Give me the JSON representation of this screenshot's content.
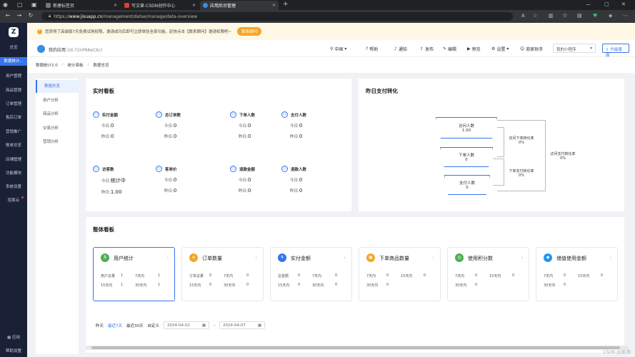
{
  "browser": {
    "tabs": [
      {
        "title": "新建标签页"
      },
      {
        "title": "写文章-CSDN创作中心"
      },
      {
        "title": "应用后台管理"
      }
    ],
    "url_prefix": "https://",
    "url_host": "www.jisuapp.cn",
    "url_path": "/management/datax/manage/data-overview"
  },
  "sidebar": {
    "logo": "Z",
    "top_label": "总览",
    "items": [
      {
        "label": "数据统计..."
      },
      {
        "label": "用户管理"
      },
      {
        "label": "商品管理"
      },
      {
        "label": "订单管理"
      },
      {
        "label": "售后订单"
      },
      {
        "label": "营销推广"
      },
      {
        "label": "账单总览"
      },
      {
        "label": "店铺管理"
      },
      {
        "label": "功能模块"
      },
      {
        "label": "系统设置"
      },
      {
        "label": "招客云"
      }
    ],
    "bottom_items": [
      {
        "label": "应用"
      },
      {
        "label": "帮助设置"
      }
    ]
  },
  "notice": {
    "text": "您获得了高级版7天免费试用权限，邀请成功后即可立即体验全部功能，赶快点击【联系顾问】邀请权限吧~",
    "button": "联系顾问"
  },
  "header": {
    "app_name": "我的应用",
    "app_id": "(id:72nP6KeC6c)",
    "region": "中国",
    "items": [
      "帮助",
      "通知",
      "发布",
      "编辑",
      "预览",
      "设置",
      "商家助手"
    ],
    "select": "我的小程序",
    "upgrade": "升级版面"
  },
  "breadcrumb": [
    "数据统计2.0",
    "统计面板",
    "数据总览"
  ],
  "subnav": [
    "数据总览",
    "用户分析",
    "商品分析",
    "交易分析",
    "营销分析"
  ],
  "realtime": {
    "title": "实时看板",
    "today_prefix": "今日:",
    "yesterday_prefix": "昨日:",
    "metrics": [
      {
        "name": "实付金额",
        "today": "0",
        "yesterday": "0"
      },
      {
        "name": "总订单数",
        "today": "0",
        "yesterday": "0"
      },
      {
        "name": "下单人数",
        "today": "0",
        "yesterday": "0"
      },
      {
        "name": "支付人数",
        "today": "0",
        "yesterday": "0"
      },
      {
        "name": "访客数",
        "today": "统计中",
        "yesterday": "1.00"
      },
      {
        "name": "客单价",
        "today": "0",
        "yesterday": "0"
      },
      {
        "name": "退款金额",
        "today": "0",
        "yesterday": "0"
      },
      {
        "name": "退款人数",
        "today": "0",
        "yesterday": "0"
      }
    ]
  },
  "funnel": {
    "title": "昨日支付转化",
    "stages": [
      {
        "name": "访问人数",
        "value": "1.00"
      },
      {
        "name": "下单人数",
        "value": "0"
      },
      {
        "name": "支付人数",
        "value": "0"
      }
    ],
    "rates": [
      {
        "name": "访问下单转化率",
        "value": "0%"
      },
      {
        "name": "下单支付转化率",
        "value": "0%"
      },
      {
        "name": "访问支付转化率",
        "value": "0%"
      }
    ]
  },
  "overall": {
    "title": "整体看板",
    "cards": [
      {
        "title": "用户统计",
        "color": "#4caf50",
        "glyph": "8",
        "rows": [
          [
            "用户总量",
            "1",
            "7天内",
            "1"
          ],
          [
            "15天内",
            "1",
            "30天内",
            "1"
          ]
        ]
      },
      {
        "title": "订单数量",
        "color": "#f5a623",
        "glyph": "≡",
        "rows": [
          [
            "订单总量",
            "0",
            "7天内",
            "0"
          ],
          [
            "15天内",
            "0",
            "30天内",
            "0"
          ]
        ]
      },
      {
        "title": "实付金额",
        "color": "#3574ee",
        "glyph": "¥",
        "rows": [
          [
            "总金额",
            "0",
            "7天内",
            "0"
          ],
          [
            "15天内",
            "0",
            "30天内",
            "0"
          ]
        ]
      },
      {
        "title": "下单商品数量",
        "color": "#f5a623",
        "glyph": "▣",
        "rows": [
          [
            "7天内",
            "0",
            "15天内",
            "0"
          ],
          [
            "30天内",
            "0",
            "",
            ""
          ]
        ]
      },
      {
        "title": "使用积分数",
        "color": "#4caf50",
        "glyph": "◎",
        "rows": [
          [
            "7天内",
            "0",
            "15天内",
            "0"
          ],
          [
            "30天内",
            "0",
            "",
            ""
          ]
        ]
      },
      {
        "title": "储值使用金额",
        "color": "#2196f3",
        "glyph": "◆",
        "rows": [
          [
            "7天内",
            "0",
            "15天内",
            "0"
          ],
          [
            "30天内",
            "0",
            "",
            ""
          ]
        ]
      }
    ]
  },
  "datebar": {
    "options": [
      "昨天",
      "最近7天",
      "最近30天",
      "自定义"
    ],
    "start": "2024-04-01",
    "sep": "-",
    "end": "2024-04-07"
  },
  "watermark": "CSDN @银.孩"
}
